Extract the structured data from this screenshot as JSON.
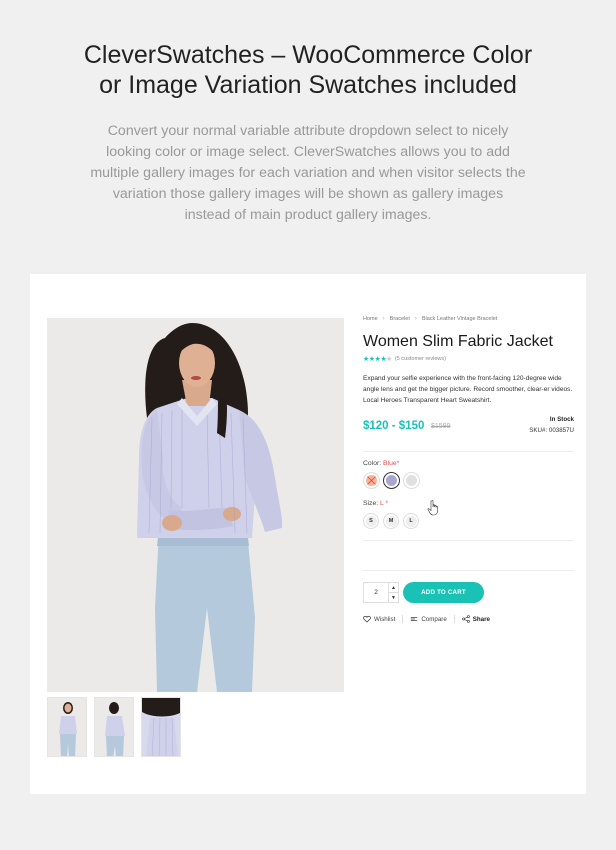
{
  "hero": {
    "title_line1": "CleverSwatches – WooCommerce Color",
    "title_line2": "or Image Variation Swatches included",
    "description": "Convert your normal variable attribute dropdown select to nicely looking color or image select. CleverSwatches allows you to add multiple gallery images for each variation and when visitor selects the variation those gallery images will be shown as gallery images instead of main product gallery images."
  },
  "breadcrumb": [
    "Home",
    "Bracelet",
    "Black Leather Vintage Bracelet"
  ],
  "product": {
    "title": "Women Slim Fabric Jacket",
    "rating": 4,
    "reviews": "(5 customer reviews)",
    "description": "Expand your selfie experience with the front-facing 120-degree wide angle lens and get the bigger picture. Record smoother, clear-er videos. Local Heroes Transparent Heart Sweatshirt.",
    "price": "$120 - $150",
    "old_price": "$1599",
    "stock": "In Stock",
    "sku": "SKU#: 003857U"
  },
  "color": {
    "label": "Color:",
    "value": "Blue",
    "required": "*",
    "swatches": [
      {
        "name": "Orange",
        "color": "#f4b49a",
        "unavailable": true
      },
      {
        "name": "Blue",
        "color": "#a9a6cf",
        "selected": true
      },
      {
        "name": "Light Gray",
        "color": "#e0e0e0"
      }
    ]
  },
  "size": {
    "label": "Size:",
    "value": "L",
    "required": "*",
    "options": [
      "S",
      "M",
      "L"
    ]
  },
  "cart": {
    "quantity": "2",
    "add_to_cart": "ADD TO CART"
  },
  "actions": {
    "wishlist": "Wishlist",
    "compare": "Compare",
    "share": "Share"
  },
  "colors": {
    "accent": "#19c2b4",
    "required": "#e24c4c"
  }
}
